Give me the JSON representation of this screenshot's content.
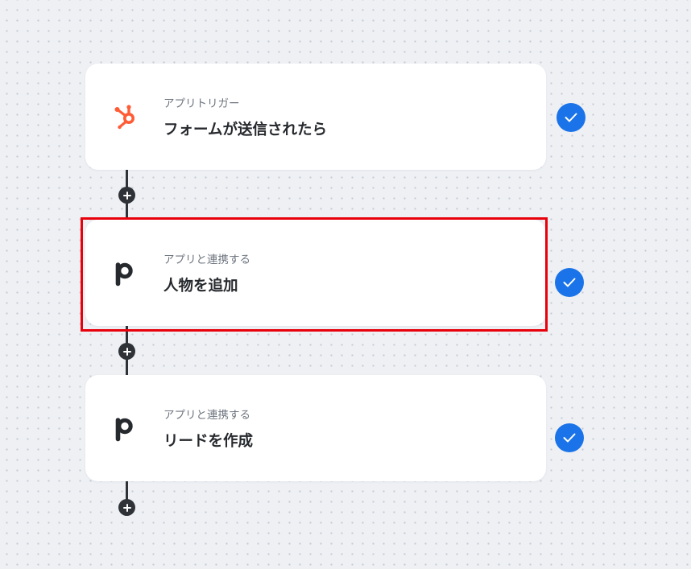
{
  "flow": {
    "steps": [
      {
        "type_label": "アプリトリガー",
        "title": "フォームが送信されたら",
        "app_icon": "hubspot-icon",
        "status": "completed"
      },
      {
        "type_label": "アプリと連携する",
        "title": "人物を追加",
        "app_icon": "pipedrive-icon",
        "status": "completed",
        "highlighted": true
      },
      {
        "type_label": "アプリと連携する",
        "title": "リードを作成",
        "app_icon": "pipedrive-icon",
        "status": "completed"
      }
    ],
    "add_step_icon": "plus-icon",
    "status_icon": "check-circle-icon"
  },
  "colors": {
    "canvas_background": "#eef0f4",
    "hubspot_orange": "#ff5c35",
    "status_blue": "#1a73e8",
    "highlight_red": "#e8000b",
    "connector": "#2f3337"
  }
}
